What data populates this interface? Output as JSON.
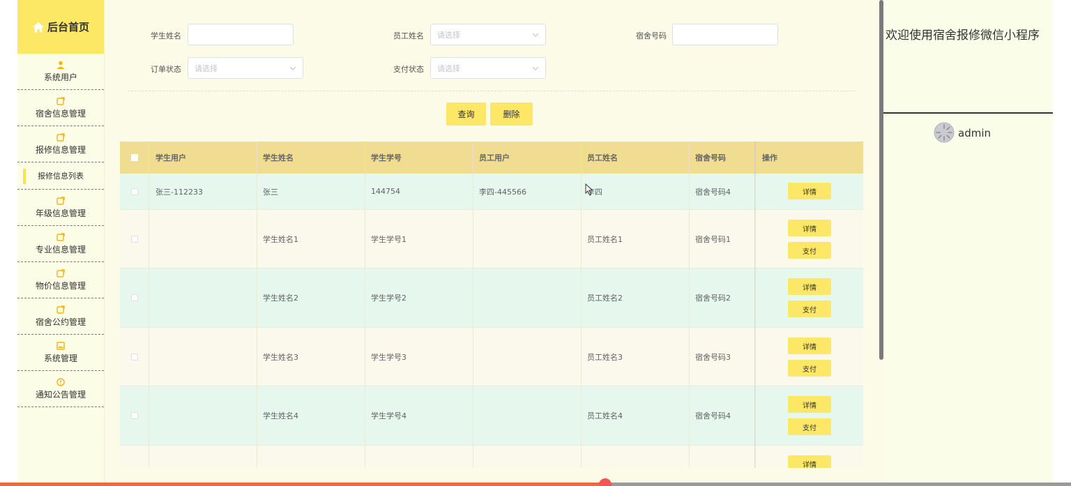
{
  "sidebar": {
    "home_label": "后台首页",
    "items": [
      {
        "label": "系统用户",
        "icon": "user-icon"
      },
      {
        "label": "宿舍信息管理",
        "icon": "edit-icon"
      },
      {
        "label": "报修信息管理",
        "icon": "edit-icon"
      },
      {
        "label": "年级信息管理",
        "icon": "edit-icon"
      },
      {
        "label": "专业信息管理",
        "icon": "edit-icon"
      },
      {
        "label": "物价信息管理",
        "icon": "edit-icon"
      },
      {
        "label": "宿舍公约管理",
        "icon": "edit-icon"
      },
      {
        "label": "系统管理",
        "icon": "image-icon"
      },
      {
        "label": "通知公告管理",
        "icon": "info-icon"
      }
    ],
    "active_sub": "报修信息列表"
  },
  "filters": {
    "student_name": {
      "label": "学生姓名",
      "value": ""
    },
    "staff_name": {
      "label": "员工姓名",
      "placeholder": "请选择"
    },
    "dorm_no": {
      "label": "宿舍号码",
      "value": ""
    },
    "order_status": {
      "label": "订单状态",
      "placeholder": "请选择"
    },
    "pay_status": {
      "label": "支付状态",
      "placeholder": "请选择"
    }
  },
  "actions": {
    "query": "查询",
    "delete": "删除"
  },
  "table": {
    "headers": [
      "学生用户",
      "学生姓名",
      "学生学号",
      "员工用户",
      "员工姓名",
      "宿舍号码",
      "操作"
    ],
    "detail_label": "详情",
    "pay_label": "支付",
    "rows": [
      {
        "student_user": "张三-112233",
        "student_name": "张三",
        "student_no": "144754",
        "staff_user": "李四-445566",
        "staff_name": "李四",
        "dorm": "宿舍号码4",
        "pay": false
      },
      {
        "student_user": "",
        "student_name": "学生姓名1",
        "student_no": "学生学号1",
        "staff_user": "",
        "staff_name": "员工姓名1",
        "dorm": "宿舍号码1",
        "pay": true
      },
      {
        "student_user": "",
        "student_name": "学生姓名2",
        "student_no": "学生学号2",
        "staff_user": "",
        "staff_name": "员工姓名2",
        "dorm": "宿舍号码2",
        "pay": true
      },
      {
        "student_user": "",
        "student_name": "学生姓名3",
        "student_no": "学生学号3",
        "staff_user": "",
        "staff_name": "员工姓名3",
        "dorm": "宿舍号码3",
        "pay": true
      },
      {
        "student_user": "",
        "student_name": "学生姓名4",
        "student_no": "学生学号4",
        "staff_user": "",
        "staff_name": "员工姓名4",
        "dorm": "宿舍号码4",
        "pay": true
      },
      {
        "student_user": "",
        "student_name": "",
        "student_no": "",
        "staff_user": "",
        "staff_name": "",
        "dorm": "",
        "pay": false
      }
    ]
  },
  "right_panel": {
    "welcome": "欢迎使用宿舍报修微信小程序",
    "username": "admin"
  },
  "video_progress": 0.565,
  "colors": {
    "accent": "#fde766",
    "header": "#f0dd92",
    "row_alt": "#e6f7ee",
    "row": "#fbf9ec"
  }
}
